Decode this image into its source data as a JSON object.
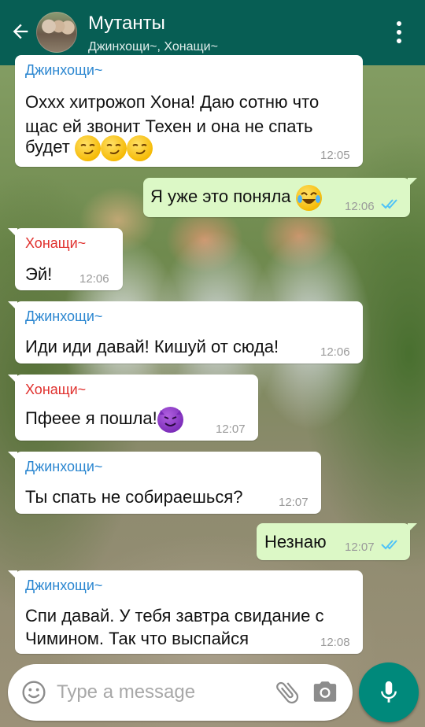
{
  "header": {
    "title": "Мутанты",
    "subtitle": "Джинхощи~, Хонащи~"
  },
  "messages": [
    {
      "sender": "Джинхощи~",
      "lines": [
        "Оxxx хитрожоп Хона! Даю сотню что",
        "щас ей звонит Техен и она не спать",
        "будет"
      ],
      "emoji": "smirking-face x3",
      "time": "12:05"
    },
    {
      "sender": "",
      "lines": [
        "Я уже это поняла"
      ],
      "emoji": "face-with-tears-of-joy",
      "time": "12:06",
      "status": "read"
    },
    {
      "sender": "Хонащи~",
      "lines": [
        "Эй!"
      ],
      "time": "12:06"
    },
    {
      "sender": "Джинхощи~",
      "lines": [
        "Иди иди давай! Кишуй от сюда!"
      ],
      "time": "12:06"
    },
    {
      "sender": "Хонащи~",
      "lines": [
        "Пфеее я пошла!"
      ],
      "emoji": "smiling-devil",
      "time": "12:07"
    },
    {
      "sender": "Джинхощи~",
      "lines": [
        "Ты спать не собираешься?"
      ],
      "time": "12:07"
    },
    {
      "sender": "",
      "lines": [
        "Незнаю"
      ],
      "time": "12:07",
      "status": "read"
    },
    {
      "sender": "Джинхощи~",
      "lines": [
        "Спи давай. У тебя завтра свидание с",
        "Чимином. Так что выспайся"
      ],
      "time": "12:08"
    }
  ],
  "input": {
    "placeholder": "Type a message"
  },
  "icons": {
    "back": "arrow-back-icon",
    "menu": "more-vert-icon",
    "emoji": "emoji-icon",
    "attach": "paperclip-icon",
    "camera": "camera-icon",
    "mic": "mic-icon",
    "read": "double-check-icon"
  },
  "colors": {
    "header": "#075e54",
    "outgoing_bubble": "#dcf8c6",
    "incoming_bubble": "#ffffff",
    "sender_blue": "#2a86d0",
    "sender_red": "#e0312e",
    "read_ticks": "#4fc3f7",
    "mic_button": "#00897b"
  }
}
